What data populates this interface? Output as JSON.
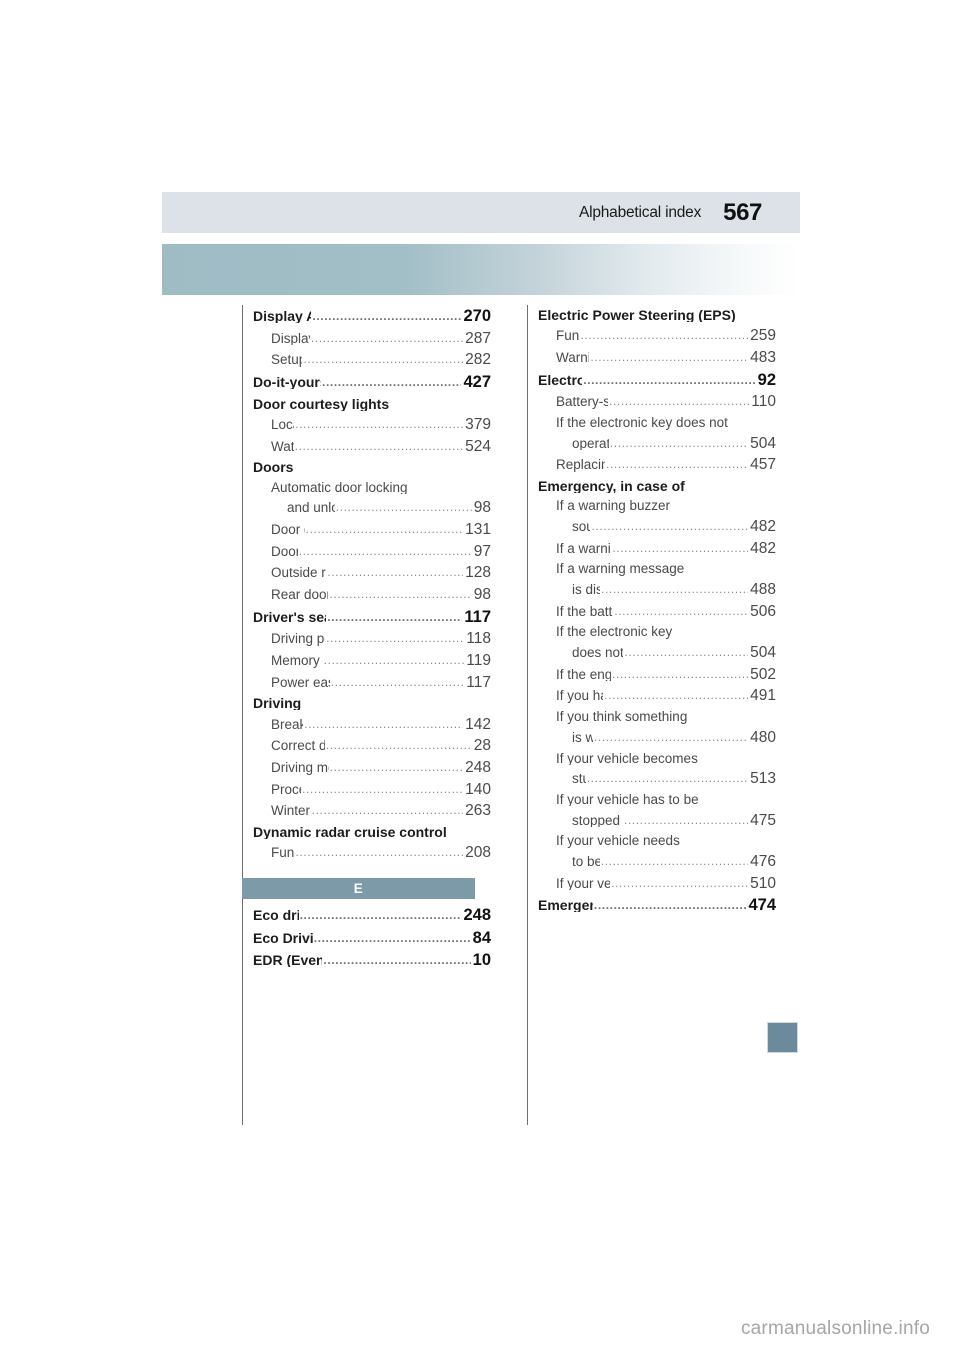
{
  "header": {
    "title": "Alphabetical index",
    "page_number": "567"
  },
  "side_tab": {
    "name": "index-thumb-tab",
    "color": "#6b8b9c"
  },
  "watermark": "carmanualsonline.info",
  "columns": [
    {
      "name": "left-column",
      "blocks": [
        {
          "type": "entries",
          "entries": [
            {
              "level": 0,
              "label": "Display Audio system",
              "page": "270"
            },
            {
              "level": 1,
              "label": "Display settings",
              "page": "287"
            },
            {
              "level": 1,
              "label": "Setup menu",
              "page": "282"
            },
            {
              "level": 0,
              "label": "Do-it-yourself maintenance",
              "page": "427"
            },
            {
              "level": 0,
              "label": "Door courtesy lights",
              "page": ""
            },
            {
              "level": 1,
              "label": "Location",
              "page": "379"
            },
            {
              "level": 1,
              "label": "Wattage",
              "page": "524"
            },
            {
              "level": 0,
              "label": "Doors",
              "page": ""
            },
            {
              "level": 1,
              "label": "Automatic door locking",
              "page": ""
            },
            {
              "level": 2,
              "label": "and unlocking system",
              "page": "98"
            },
            {
              "level": 1,
              "label": "Door glasses",
              "page": "131"
            },
            {
              "level": 1,
              "label": "Door lock",
              "page": "97"
            },
            {
              "level": 1,
              "label": "Outside rear view mirrors",
              "page": "128"
            },
            {
              "level": 1,
              "label": "Rear door child-protector",
              "page": "98"
            },
            {
              "level": 0,
              "label": "Driver's seat position memory",
              "page": "117"
            },
            {
              "level": 1,
              "label": "Driving position memory",
              "page": "118"
            },
            {
              "level": 1,
              "label": "Memory recall function",
              "page": "119"
            },
            {
              "level": 1,
              "label": "Power easy access system",
              "page": "117"
            },
            {
              "level": 0,
              "label": "Driving",
              "page": ""
            },
            {
              "level": 1,
              "label": "Break-in tips",
              "page": "142"
            },
            {
              "level": 1,
              "label": "Correct driving posture",
              "page": "28"
            },
            {
              "level": 1,
              "label": "Driving mode select switch",
              "page": "248"
            },
            {
              "level": 1,
              "label": "Procedures",
              "page": "140"
            },
            {
              "level": 1,
              "label": "Winter drive tips",
              "page": "263"
            },
            {
              "level": 0,
              "label": "Dynamic radar cruise control",
              "page": ""
            },
            {
              "level": 1,
              "label": "Function",
              "page": "208"
            }
          ]
        },
        {
          "type": "section",
          "letter": "E"
        },
        {
          "type": "entries",
          "entries": [
            {
              "level": 0,
              "label": "Eco drive mode",
              "page": "248"
            },
            {
              "level": 0,
              "label": "Eco Driving Indicator",
              "page": "84"
            },
            {
              "level": 0,
              "label": "EDR (Event data recorder)",
              "page": "10"
            }
          ]
        }
      ]
    },
    {
      "name": "right-column",
      "blocks": [
        {
          "type": "entries",
          "entries": [
            {
              "level": 0,
              "label": "Electric Power Steering (EPS)",
              "page": ""
            },
            {
              "level": 1,
              "label": "Function",
              "page": "259"
            },
            {
              "level": 1,
              "label": "Warning light",
              "page": "483"
            },
            {
              "level": 0,
              "label": "Electronic key",
              "page": "92"
            },
            {
              "level": 1,
              "label": "Battery-saving function",
              "page": "110"
            },
            {
              "level": 1,
              "label": "If the electronic key does not",
              "page": ""
            },
            {
              "level": 2,
              "label": "operate properly",
              "page": "504"
            },
            {
              "level": 1,
              "label": "Replacing the battery",
              "page": "457"
            },
            {
              "level": 0,
              "label": "Emergency, in case of",
              "page": ""
            },
            {
              "level": 1,
              "label": "If a warning buzzer",
              "page": ""
            },
            {
              "level": 2,
              "label": "sounds",
              "page": "482"
            },
            {
              "level": 1,
              "label": "If a warning light turns on",
              "page": "482"
            },
            {
              "level": 1,
              "label": "If a warning message",
              "page": ""
            },
            {
              "level": 2,
              "label": "is displayed",
              "page": "488"
            },
            {
              "level": 1,
              "label": "If the battery is discharged",
              "page": "506"
            },
            {
              "level": 1,
              "label": "If the electronic key",
              "page": ""
            },
            {
              "level": 2,
              "label": "does not operate properly",
              "page": "504"
            },
            {
              "level": 1,
              "label": "If the engine will not start",
              "page": "502"
            },
            {
              "level": 1,
              "label": "If you have a flat tire",
              "page": "491"
            },
            {
              "level": 1,
              "label": "If you think something",
              "page": ""
            },
            {
              "level": 2,
              "label": "is wrong",
              "page": "480"
            },
            {
              "level": 1,
              "label": "If your vehicle becomes",
              "page": ""
            },
            {
              "level": 2,
              "label": "stuck",
              "page": "513"
            },
            {
              "level": 1,
              "label": "If your vehicle has to be",
              "page": ""
            },
            {
              "level": 2,
              "label": "stopped in an emergency",
              "page": "475"
            },
            {
              "level": 1,
              "label": "If your vehicle needs",
              "page": ""
            },
            {
              "level": 2,
              "label": "to be towed",
              "page": "476"
            },
            {
              "level": 1,
              "label": "If your vehicle overheats",
              "page": "510"
            },
            {
              "level": 0,
              "label": "Emergency flashers",
              "page": "474"
            }
          ]
        }
      ]
    }
  ]
}
